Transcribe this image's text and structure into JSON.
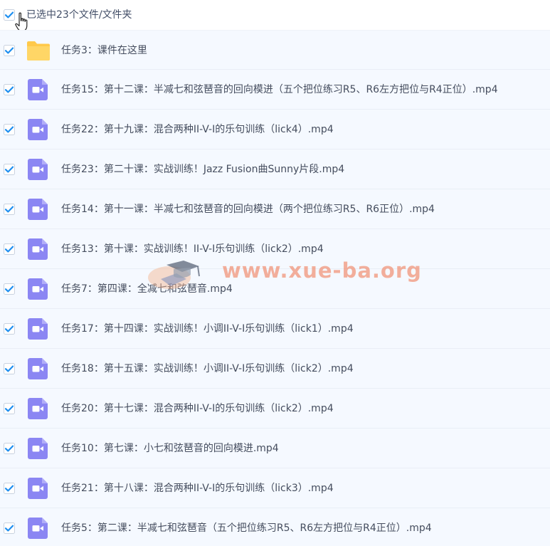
{
  "header": {
    "selection_label": "已选中23个文件/文件夹"
  },
  "icons": {
    "folder": "folder-icon",
    "video": "video-file-icon",
    "checkbox": "checkbox-checked-icon"
  },
  "colors": {
    "check": "#1e8ff0",
    "folder": "#ffc94a",
    "video_bg": "#8b86f3",
    "text": "#454d5e",
    "watermark": "#f1805e"
  },
  "files": [
    {
      "name": "任务3：课件在这里",
      "type": "folder",
      "checked": true
    },
    {
      "name": "任务15：第十二课：半减七和弦琶音的回向模进（五个把位练习R5、R6左方把位与R4正位）.mp4",
      "type": "video",
      "checked": true
    },
    {
      "name": "任务22：第十九课：混合两种II-V-I的乐句训练（lick4）.mp4",
      "type": "video",
      "checked": true
    },
    {
      "name": "任务23：第二十课：实战训练！Jazz Fusion曲Sunny片段.mp4",
      "type": "video",
      "checked": true
    },
    {
      "name": "任务14：第十一课：半减七和弦琶音的回向模进（两个把位练习R5、R6正位）.mp4",
      "type": "video",
      "checked": true
    },
    {
      "name": "任务13：第十课：实战训练！II-V-I乐句训练（lick2）.mp4",
      "type": "video",
      "checked": true
    },
    {
      "name": "任务7：第四课：全减七和弦琶音.mp4",
      "type": "video",
      "checked": true
    },
    {
      "name": "任务17：第十四课：实战训练！小调II-V-I乐句训练（lick1）.mp4",
      "type": "video",
      "checked": true
    },
    {
      "name": "任务18：第十五课：实战训练！小调II-V-I乐句训练（lick2）.mp4",
      "type": "video",
      "checked": true
    },
    {
      "name": "任务20：第十七课：混合两种II-V-I的乐句训练（lick2）.mp4",
      "type": "video",
      "checked": true
    },
    {
      "name": "任务10：第七课：小七和弦琶音的回向模进.mp4",
      "type": "video",
      "checked": true
    },
    {
      "name": "任务21：第十八课：混合两种II-V-I的乐句训练（lick3）.mp4",
      "type": "video",
      "checked": true
    },
    {
      "name": "任务5：第二课：半减七和弦琶音（五个把位练习R5、R6左方把位与R4正位）.mp4",
      "type": "video",
      "checked": true
    }
  ],
  "watermark": {
    "text": "www.xue-ba.org"
  }
}
